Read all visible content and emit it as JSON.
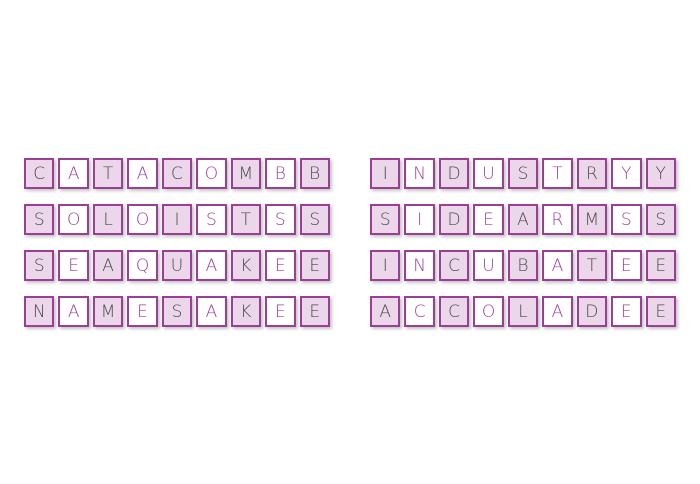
{
  "colors": {
    "border": "#9b3f96",
    "shaded_fill": "#ecd7ea",
    "plain_fill": "#ffffff",
    "shaded_text": "#4a4a4a",
    "plain_text": "#9b3f96"
  },
  "words": [
    {
      "word": "CATACOMB",
      "letters": [
        "C",
        "A",
        "T",
        "A",
        "C",
        "O",
        "M",
        "B",
        "B"
      ],
      "shaded": [
        true,
        false,
        true,
        false,
        true,
        false,
        true,
        false,
        true
      ]
    },
    {
      "word": "INDUSTRY",
      "letters": [
        "I",
        "N",
        "D",
        "U",
        "S",
        "T",
        "R",
        "Y",
        "Y"
      ],
      "shaded": [
        true,
        false,
        true,
        false,
        true,
        false,
        true,
        false,
        true
      ]
    },
    {
      "word": "SOLOISTS",
      "letters": [
        "S",
        "O",
        "L",
        "O",
        "I",
        "S",
        "T",
        "S",
        "S"
      ],
      "shaded": [
        true,
        false,
        true,
        false,
        true,
        false,
        true,
        false,
        true
      ]
    },
    {
      "word": "SIDEARMS",
      "letters": [
        "S",
        "I",
        "D",
        "E",
        "A",
        "R",
        "M",
        "S",
        "S"
      ],
      "shaded": [
        true,
        false,
        true,
        false,
        true,
        false,
        true,
        false,
        true
      ]
    },
    {
      "word": "SEAQUAKE",
      "letters": [
        "S",
        "E",
        "A",
        "Q",
        "U",
        "A",
        "K",
        "E",
        "E"
      ],
      "shaded": [
        true,
        false,
        true,
        false,
        true,
        false,
        true,
        false,
        true
      ]
    },
    {
      "word": "INCUBATE",
      "letters": [
        "I",
        "N",
        "C",
        "U",
        "B",
        "A",
        "T",
        "E",
        "E"
      ],
      "shaded": [
        true,
        false,
        true,
        false,
        true,
        false,
        true,
        false,
        true
      ]
    },
    {
      "word": "NAMESAKE",
      "letters": [
        "N",
        "A",
        "M",
        "E",
        "S",
        "A",
        "K",
        "E",
        "E"
      ],
      "shaded": [
        true,
        false,
        true,
        false,
        true,
        false,
        true,
        false,
        true
      ]
    },
    {
      "word": "ACCOLADE",
      "letters": [
        "A",
        "C",
        "C",
        "O",
        "L",
        "A",
        "D",
        "E",
        "E"
      ],
      "shaded": [
        true,
        false,
        true,
        false,
        true,
        false,
        true,
        false,
        true
      ]
    }
  ]
}
